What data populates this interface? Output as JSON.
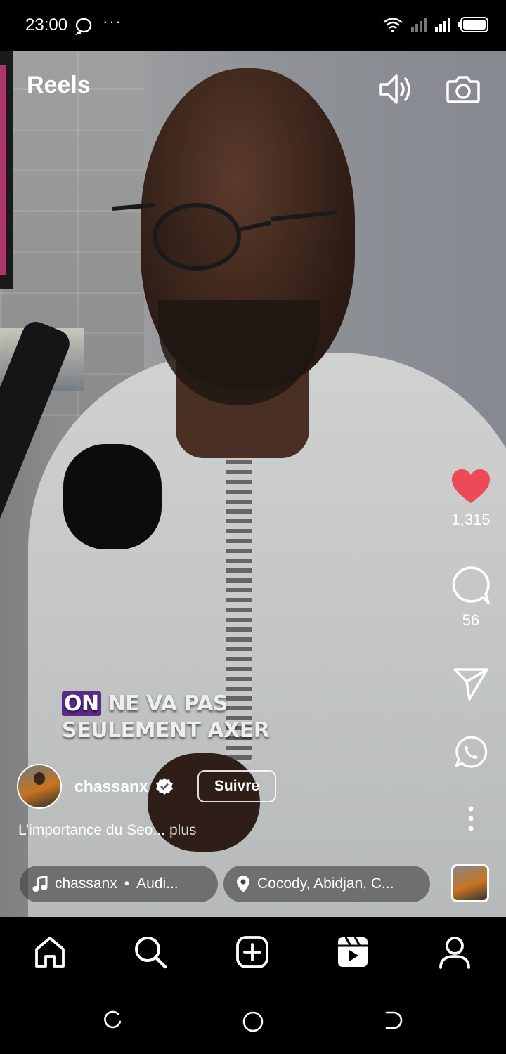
{
  "status_bar": {
    "time": "23:00",
    "dots": "···"
  },
  "header": {
    "title": "Reels"
  },
  "video": {
    "caption_highlight": "ON",
    "caption_line1_rest": "NE VA PAS",
    "caption_line2": "SEULEMENT AXER"
  },
  "actions": {
    "likes": "1,315",
    "comments": "56",
    "like_color": "#ed4956"
  },
  "author": {
    "username": "chassanx",
    "follow_label": "Suivre"
  },
  "description": {
    "text": "L’importance du Seo...",
    "more": "plus"
  },
  "audio": {
    "artist": "chassanx",
    "separator": "•",
    "title": "Audi..."
  },
  "location": {
    "text": "Cocody, Abidjan, C..."
  },
  "bottom_nav": {
    "items": [
      "home-icon",
      "search-icon",
      "create-icon",
      "reels-icon",
      "profile-icon"
    ]
  }
}
